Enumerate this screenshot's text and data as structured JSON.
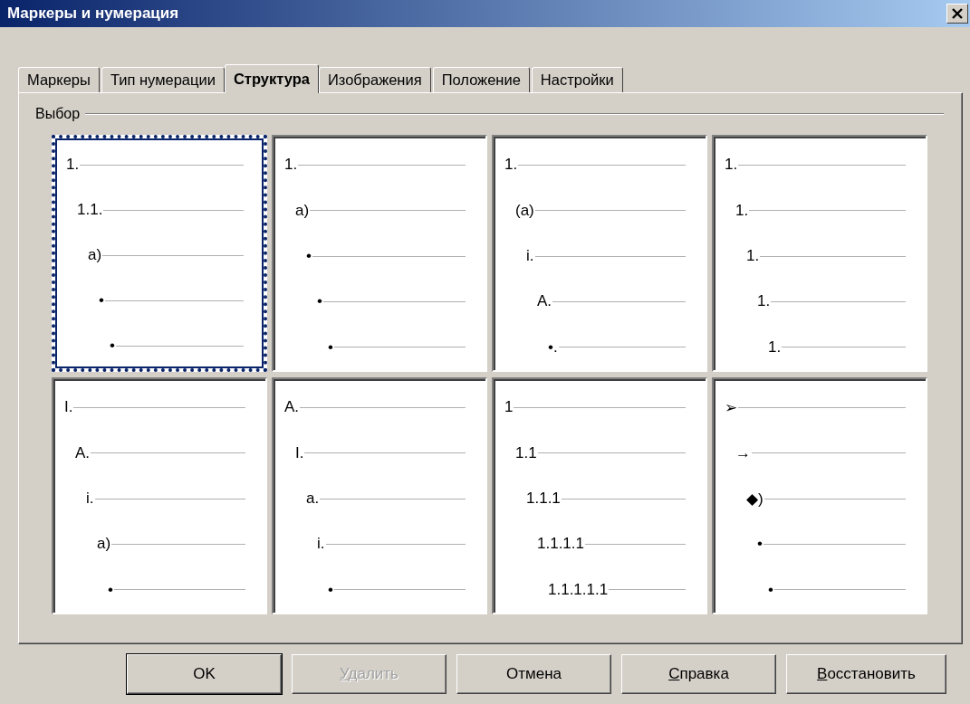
{
  "window": {
    "title": "Маркеры и нумерация"
  },
  "tabs": [
    {
      "label": "Маркеры",
      "selected": false
    },
    {
      "label": "Тип нумерации",
      "selected": false
    },
    {
      "label": "Структура",
      "selected": true
    },
    {
      "label": "Изображения",
      "selected": false
    },
    {
      "label": "Положение",
      "selected": false
    },
    {
      "label": "Настройки",
      "selected": false
    }
  ],
  "group": {
    "label": "Выбор"
  },
  "cells": [
    {
      "selected": true,
      "markers": [
        "1.",
        "1.1.",
        "a)",
        "•",
        "•"
      ]
    },
    {
      "selected": false,
      "markers": [
        "1.",
        "a)",
        "•",
        "•",
        "•"
      ]
    },
    {
      "selected": false,
      "markers": [
        "1.",
        "(a)",
        "i.",
        "A.",
        "•."
      ]
    },
    {
      "selected": false,
      "markers": [
        "1.",
        "1.",
        "1.",
        "1.",
        "1."
      ]
    },
    {
      "selected": false,
      "markers": [
        "I.",
        "A.",
        "i.",
        "a)",
        "•"
      ]
    },
    {
      "selected": false,
      "markers": [
        "A.",
        "I.",
        "a.",
        "i.",
        "•"
      ]
    },
    {
      "selected": false,
      "markers": [
        "1",
        "1.1",
        "1.1.1",
        "1.1.1.1",
        "1.1.1.1.1"
      ]
    },
    {
      "selected": false,
      "markers": [
        "➢",
        "→",
        "◆)",
        "•",
        "•"
      ]
    }
  ],
  "buttons": [
    {
      "label": "OK",
      "disabled": false,
      "default": true,
      "underline_first": false
    },
    {
      "label": "Удалить",
      "disabled": true,
      "default": false,
      "underline_first": true
    },
    {
      "label": "Отмена",
      "disabled": false,
      "default": false,
      "underline_first": false
    },
    {
      "label": "Справка",
      "disabled": false,
      "default": false,
      "underline_first": true
    },
    {
      "label": "Восстановить",
      "disabled": false,
      "default": false,
      "underline_first": true
    }
  ]
}
